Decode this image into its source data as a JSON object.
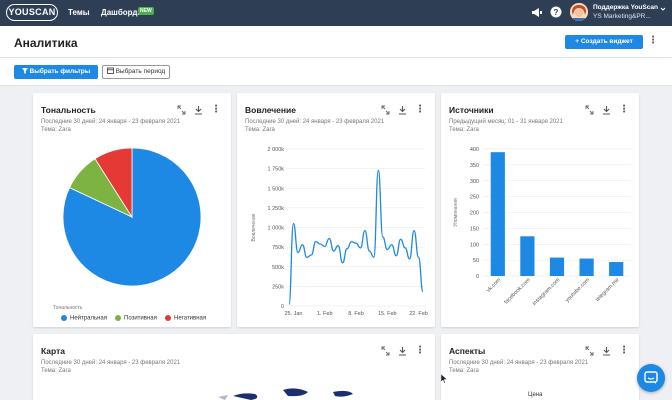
{
  "topbar": {
    "logo": "YOUSCAN",
    "nav": [
      {
        "label": "Темы"
      },
      {
        "label": "Дашборды",
        "badge": "NEW"
      }
    ],
    "user_name": "Поддержка YouScan",
    "user_org": "YS Marketing&PR..."
  },
  "header": {
    "title": "Аналитика",
    "create_widget_label": "Создать виджет"
  },
  "filters": {
    "select_filters_label": "Выбрать фильтры",
    "select_period_label": "Выбрать период"
  },
  "cards": {
    "sentiment": {
      "title": "Тональность",
      "period": "Последние 30 дней: 24 января - 23 февраля 2021",
      "topic": "Тема: Zara",
      "legend_title": "Тональность",
      "legend": [
        {
          "label": "Нейтральная",
          "color": "#1e88e5"
        },
        {
          "label": "Позитивная",
          "color": "#7cb342"
        },
        {
          "label": "Негативная",
          "color": "#e53935"
        }
      ]
    },
    "engagement": {
      "title": "Вовлечение",
      "period": "Последние 30 дней: 24 января - 23 февраля 2021",
      "topic": "Тема: Zara",
      "ylabel": "Вовлечение"
    },
    "sources": {
      "title": "Источники",
      "period": "Предыдущий месяц: 01 - 31 января 2021",
      "topic": "Тема: Zara",
      "ylabel": "Упоминания"
    },
    "map": {
      "title": "Карта",
      "period": "Последние 30 дней: 24 января - 23 февраля 2021",
      "topic": "Тема: Zara"
    },
    "aspects": {
      "title": "Аспекты",
      "period": "Последние 30 дней: 24 января - 23 февраля 2021",
      "topic": "Тема: Zara",
      "peek_label": "Цена"
    }
  },
  "chart_data": [
    {
      "type": "pie",
      "title": "Тональность",
      "categories": [
        "Нейтральная",
        "Позитивная",
        "Негативная"
      ],
      "values": [
        82,
        9,
        9
      ],
      "colors": [
        "#1e88e5",
        "#7cb342",
        "#e53935"
      ],
      "legend": "bottom"
    },
    {
      "type": "line",
      "title": "Вовлечение",
      "ylabel": "Вовлечение",
      "ylim": [
        0,
        2000
      ],
      "yticks": [
        "0",
        "250k",
        "500k",
        "750k",
        "1 000k",
        "1 250k",
        "1 500k",
        "1 750k",
        "2 000k"
      ],
      "xticks": [
        "25. Jan",
        "1. Feb",
        "8. Feb",
        "15. Feb",
        "22. Feb"
      ],
      "x": [
        "24. Jan",
        "25. Jan",
        "26. Jan",
        "27. Jan",
        "28. Jan",
        "29. Jan",
        "30. Jan",
        "31. Jan",
        "1. Feb",
        "2. Feb",
        "3. Feb",
        "4. Feb",
        "5. Feb",
        "6. Feb",
        "7. Feb",
        "8. Feb",
        "9. Feb",
        "10. Feb",
        "11. Feb",
        "12. Feb",
        "13. Feb",
        "14. Feb",
        "15. Feb",
        "16. Feb",
        "17. Feb",
        "18. Feb",
        "19. Feb",
        "20. Feb",
        "21. Feb",
        "22. Feb",
        "23. Feb"
      ],
      "series": [
        {
          "values": [
            20,
            1050,
            680,
            780,
            620,
            650,
            820,
            790,
            760,
            860,
            700,
            770,
            550,
            730,
            820,
            800,
            740,
            960,
            700,
            620,
            1730,
            880,
            720,
            780,
            640,
            850,
            740,
            600,
            960,
            620,
            180
          ]
        }
      ],
      "grid": true
    },
    {
      "type": "bar",
      "title": "Источники",
      "ylabel": "Упоминания",
      "ylim": [
        0,
        400
      ],
      "yticks": [
        "0",
        "50",
        "100",
        "150",
        "200",
        "250",
        "300",
        "350",
        "400"
      ],
      "categories": [
        "vk.com",
        "facebook.com",
        "instagram.com",
        "youtube.com",
        "telegram.me"
      ],
      "values": [
        390,
        125,
        58,
        55,
        44
      ],
      "color": "#1e88e5",
      "grid": true
    }
  ]
}
